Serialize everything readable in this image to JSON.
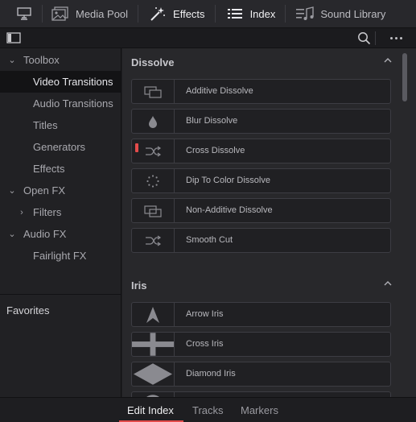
{
  "toolbar": {
    "items": [
      {
        "label": "",
        "icon": "monitor-icon"
      },
      {
        "label": "Media Pool",
        "icon": "media-pool-icon"
      },
      {
        "label": "Effects",
        "icon": "effects-wand-icon",
        "active": true
      },
      {
        "label": "Index",
        "icon": "index-list-icon",
        "active": true
      },
      {
        "label": "Sound Library",
        "icon": "sound-library-icon"
      }
    ]
  },
  "subbar": {
    "sidebar_toggle_icon": "sidebar-toggle-icon",
    "search_icon": "search-icon",
    "more_icon": "more-options-icon"
  },
  "sidebar": {
    "items": [
      {
        "label": "Toolbox",
        "expanded": true,
        "level": 0
      },
      {
        "label": "Video Transitions",
        "level": 1,
        "selected": true
      },
      {
        "label": "Audio Transitions",
        "level": 1
      },
      {
        "label": "Titles",
        "level": 1
      },
      {
        "label": "Generators",
        "level": 1
      },
      {
        "label": "Effects",
        "level": 1
      },
      {
        "label": "Open FX",
        "expanded": true,
        "level": 0
      },
      {
        "label": "Filters",
        "expanded": false,
        "level": 1
      },
      {
        "label": "Audio FX",
        "expanded": true,
        "level": 0
      },
      {
        "label": "Fairlight FX",
        "level": 1
      }
    ],
    "favorites": "Favorites"
  },
  "main": {
    "sections": [
      {
        "title": "Dissolve",
        "items": [
          {
            "label": "Additive Dissolve",
            "icon": "additive-dissolve-icon"
          },
          {
            "label": "Blur Dissolve",
            "icon": "blur-drop-icon"
          },
          {
            "label": "Cross Dissolve",
            "icon": "cross-dissolve-icon",
            "marked": true
          },
          {
            "label": "Dip To Color Dissolve",
            "icon": "dotted-circle-icon"
          },
          {
            "label": "Non-Additive Dissolve",
            "icon": "non-additive-dissolve-icon"
          },
          {
            "label": "Smooth Cut",
            "icon": "smooth-cut-icon"
          }
        ]
      },
      {
        "title": "Iris",
        "items": [
          {
            "label": "Arrow Iris",
            "icon": "arrow-iris-icon"
          },
          {
            "label": "Cross Iris",
            "icon": "cross-iris-icon"
          },
          {
            "label": "Diamond Iris",
            "icon": "diamond-iris-icon"
          },
          {
            "label": "",
            "icon": "circle-iris-icon"
          }
        ]
      }
    ]
  },
  "bottom_tabs": [
    {
      "label": "Edit Index",
      "active": true
    },
    {
      "label": "Tracks"
    },
    {
      "label": "Markers"
    }
  ],
  "colors": {
    "accent": "#e34b4b",
    "panel": "#28282b",
    "sidebar": "#212124",
    "selected_row": "#131315"
  }
}
